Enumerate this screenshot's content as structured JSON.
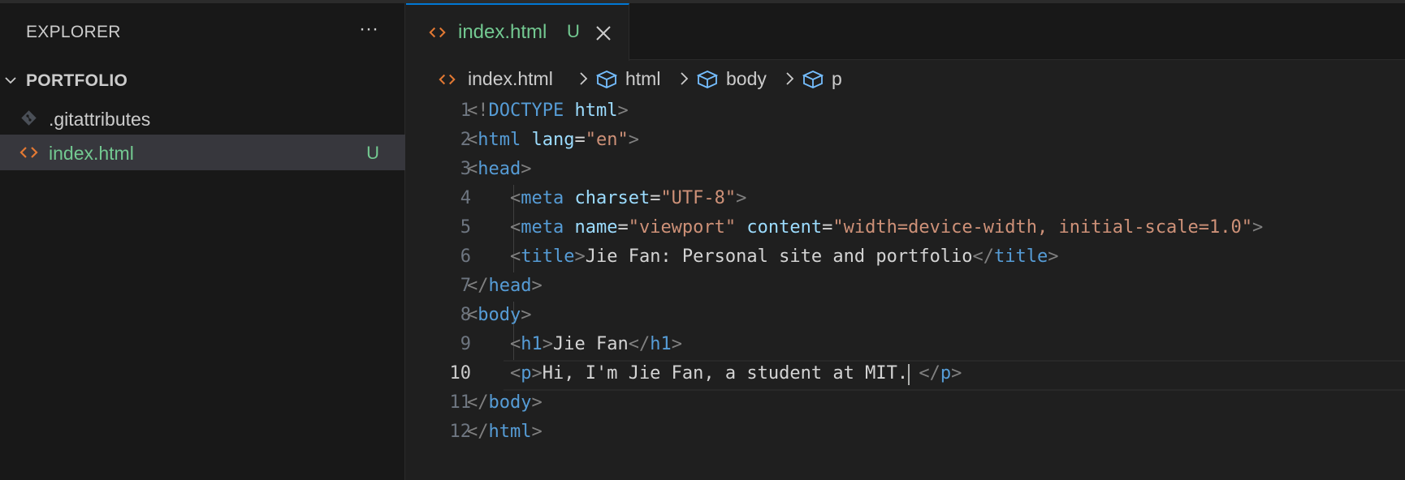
{
  "sidebar": {
    "title": "EXPLORER",
    "more_label": "···",
    "folder": "PORTFOLIO",
    "files": [
      {
        "name": ".gitattributes",
        "badge": ""
      },
      {
        "name": "index.html",
        "badge": "U"
      }
    ]
  },
  "editor": {
    "tab": {
      "name": "index.html",
      "badge": "U"
    },
    "breadcrumb": [
      "index.html",
      "html",
      "body",
      "p"
    ],
    "lines": [
      {
        "num": "1",
        "text": "<!DOCTYPE html>"
      },
      {
        "num": "2",
        "text": "<html lang=\"en\">"
      },
      {
        "num": "3",
        "text": "<head>"
      },
      {
        "num": "4",
        "text": "    <meta charset=\"UTF-8\">"
      },
      {
        "num": "5",
        "text": "    <meta name=\"viewport\" content=\"width=device-width, initial-scale=1.0\">"
      },
      {
        "num": "6",
        "text": "    <title>Jie Fan: Personal site and portfolio</title>"
      },
      {
        "num": "7",
        "text": "</head>"
      },
      {
        "num": "8",
        "text": "<body>"
      },
      {
        "num": "9",
        "text": "    <h1>Jie Fan</h1>"
      },
      {
        "num": "10",
        "text": "    <p>Hi, I'm Jie Fan, a student at MIT. </p>"
      },
      {
        "num": "11",
        "text": "</body>"
      },
      {
        "num": "12",
        "text": "</html>"
      }
    ],
    "current_line": 10
  },
  "colors": {
    "accent": "#0078d4",
    "git_untracked": "#73c991",
    "html_icon": "#e37933",
    "tag": "#569cd6",
    "attribute": "#9cdcfe",
    "string": "#ce9178"
  },
  "icons": {
    "html_file": "html-file-icon",
    "git_file": "git-file-icon",
    "breadcrumb_element": "cube-icon",
    "close": "close-icon",
    "folder_toggle": "chevron-down-icon"
  }
}
